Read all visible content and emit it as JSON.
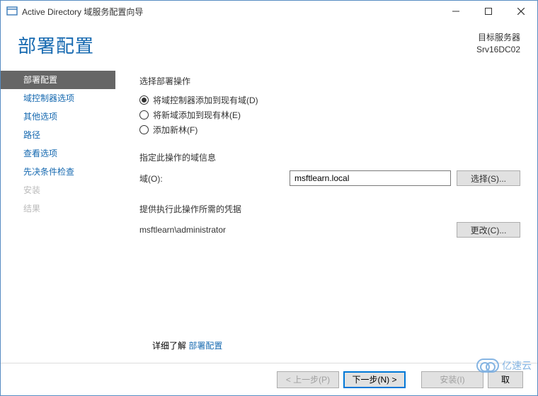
{
  "window": {
    "title": "Active Directory 域服务配置向导"
  },
  "header": {
    "page_title": "部署配置",
    "target_label": "目标服务器",
    "target_server": "Srv16DC02"
  },
  "sidebar": {
    "items": [
      {
        "label": "部署配置",
        "state": "active"
      },
      {
        "label": "域控制器选项",
        "state": "normal"
      },
      {
        "label": "其他选项",
        "state": "normal"
      },
      {
        "label": "路径",
        "state": "normal"
      },
      {
        "label": "查看选项",
        "state": "normal"
      },
      {
        "label": "先决条件检查",
        "state": "normal"
      },
      {
        "label": "安装",
        "state": "disabled"
      },
      {
        "label": "结果",
        "state": "disabled"
      }
    ]
  },
  "main": {
    "select_op_label": "选择部署操作",
    "radios": [
      {
        "label": "将域控制器添加到现有域(D)",
        "selected": true
      },
      {
        "label": "将新域添加到现有林(E)",
        "selected": false
      },
      {
        "label": "添加新林(F)",
        "selected": false
      }
    ],
    "domain_section_label": "指定此操作的域信息",
    "domain_field_label": "域(O):",
    "domain_value": "msftlearn.local",
    "select_button": "选择(S)...",
    "cred_section_label": "提供执行此操作所需的凭据",
    "cred_user": "msftlearn\\administrator",
    "change_button": "更改(C)...",
    "learn_more_prefix": "详细了解 ",
    "learn_more_link": "部署配置"
  },
  "footer": {
    "prev": "< 上一步(P)",
    "next": "下一步(N) >",
    "install": "安装(I)",
    "cancel": "取"
  },
  "watermark": "亿速云"
}
